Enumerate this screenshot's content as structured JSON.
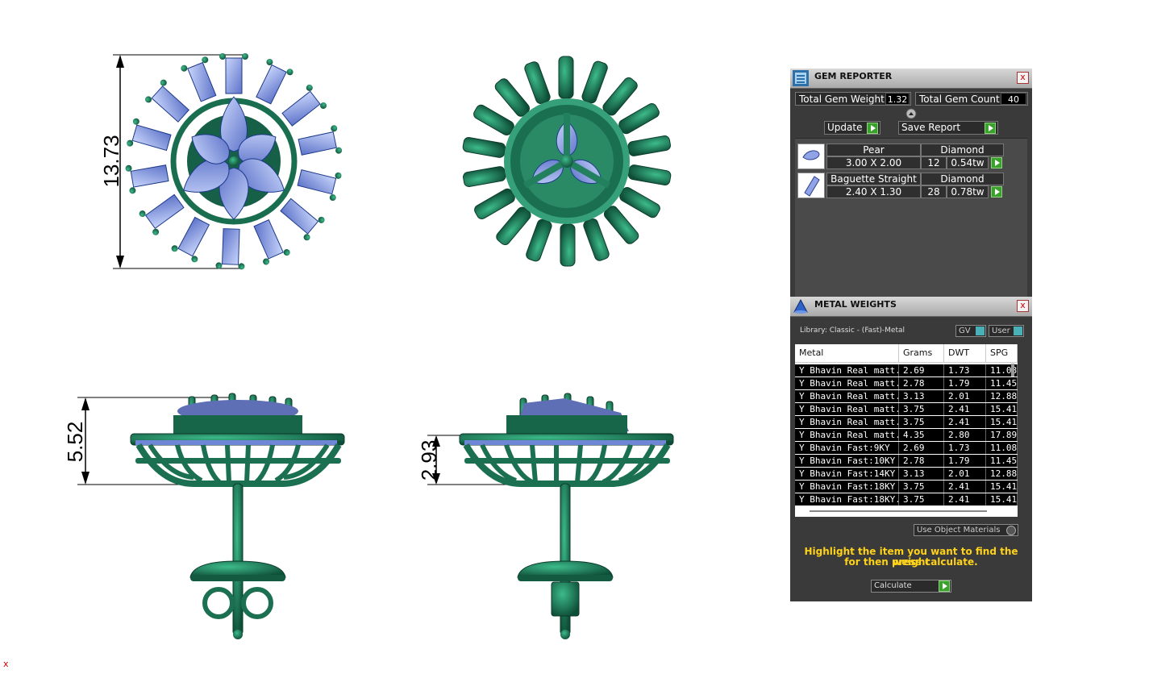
{
  "drawing": {
    "dimensions": {
      "top_height": "13.73",
      "side_height": "5.52",
      "side_height_2": "2.93"
    },
    "colors": {
      "metal": "#1c7a5a",
      "metal_dark": "#0f4f3a",
      "gem": "#7f95e0",
      "gem_light": "#b6c5f2"
    }
  },
  "gem_reporter": {
    "title": "GEM REPORTER",
    "total_weight_label": "Total Gem Weight",
    "total_weight_value": "1.32",
    "total_count_label": "Total Gem Count",
    "total_count_value": "40",
    "update_label": "Update",
    "save_report_label": "Save Report",
    "close": "x",
    "gems": [
      {
        "shape": "Pear",
        "type": "Diamond",
        "size": "3.00 X 2.00",
        "count": "12",
        "weight": "0.54tw"
      },
      {
        "shape": "Baguette Straight",
        "type": "Diamond",
        "size": "2.40 X 1.30",
        "count": "28",
        "weight": "0.78tw"
      }
    ]
  },
  "metal_weights": {
    "title": "METAL WEIGHTS",
    "close": "x",
    "library": "Library: Classic - (Fast)-Metal",
    "gv_label": "GV",
    "user_label": "User",
    "columns": [
      "Metal",
      "Grams",
      "DWT",
      "SPG"
    ],
    "rows": [
      [
        "Y Bhavin Real matt...",
        "2.69",
        "1.73",
        "11.08"
      ],
      [
        "Y Bhavin Real matt...",
        "2.78",
        "1.79",
        "11.45"
      ],
      [
        "Y Bhavin Real matt...",
        "3.13",
        "2.01",
        "12.88"
      ],
      [
        "Y Bhavin Real matt...",
        "3.75",
        "2.41",
        "15.41"
      ],
      [
        "Y Bhavin Real matt...",
        "3.75",
        "2.41",
        "15.41"
      ],
      [
        "Y Bhavin Real matt...",
        "4.35",
        "2.80",
        "17.89"
      ],
      [
        "Y Bhavin Fast:9KY",
        "2.69",
        "1.73",
        "11.08"
      ],
      [
        "Y Bhavin Fast:10KY",
        "2.78",
        "1.79",
        "11.45"
      ],
      [
        "Y Bhavin Fast:14KY",
        "3.13",
        "2.01",
        "12.88"
      ],
      [
        "Y Bhavin Fast:18KY",
        "3.75",
        "2.41",
        "15.41"
      ],
      [
        "Y Bhavin Fast:18KY...",
        "3.75",
        "2.41",
        "15.41"
      ]
    ],
    "use_object_materials": "Use Object Materials",
    "hint_line1": "Highlight the item you want to find the weight",
    "hint_line2": "for then press calculate.",
    "calculate_label": "Calculate"
  },
  "corner_mark": "x"
}
